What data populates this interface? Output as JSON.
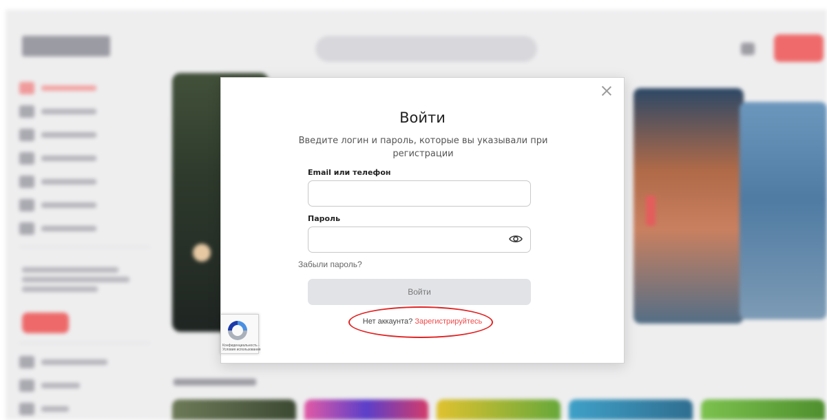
{
  "modal": {
    "title": "Войти",
    "subtitle": "Введите логин и пароль, которые вы указывали при регистрации",
    "email_label": "Email или телефон",
    "email_value": "",
    "password_label": "Пароль",
    "password_value": "",
    "forgot_password": "Забыли пароль?",
    "submit_label": "Войти",
    "no_account_text": "Нет аккаунта?",
    "register_link": "Зарегистрируйтесь",
    "close_icon": "close-icon",
    "eye_icon": "eye-icon"
  },
  "recaptcha": {
    "line1": "Конфиденциальность -",
    "line2": "Условия использования"
  },
  "colors": {
    "accent": "#ef4a4a",
    "annotation": "#e02222",
    "submit_bg": "#e2e3e7"
  }
}
